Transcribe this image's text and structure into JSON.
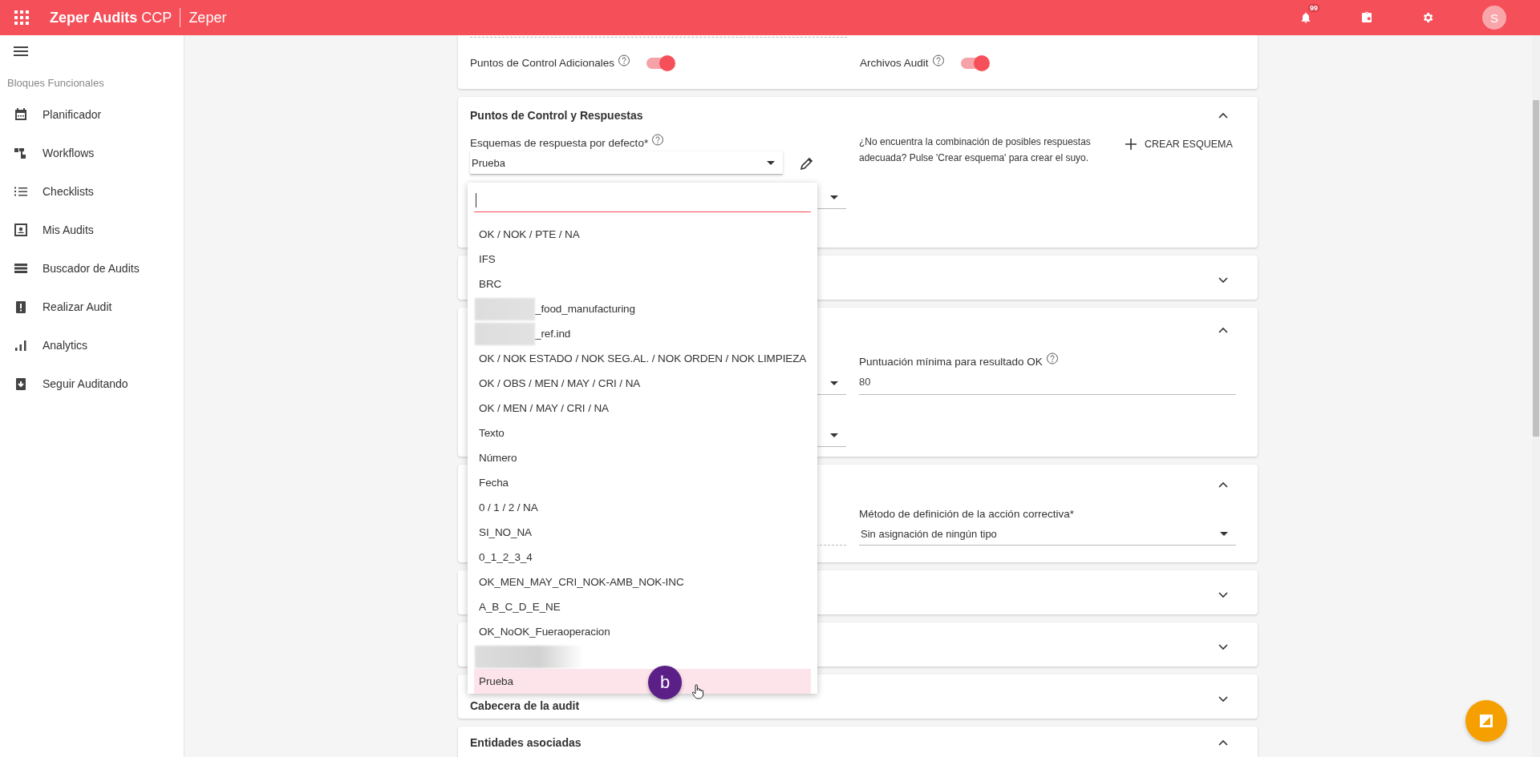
{
  "topbar": {
    "app_name": "**Zeper Audits** CCP",
    "org": "Zeper",
    "notifications_badge": "99",
    "avatar": "S"
  },
  "sidebar": {
    "section": "Bloques Funcionales",
    "items": [
      {
        "kind": "calendar",
        "label": "Planificador"
      },
      {
        "kind": "workflow",
        "label": "Workflows"
      },
      {
        "kind": "list",
        "label": "Checklists"
      },
      {
        "kind": "person",
        "label": "Mis Audits"
      },
      {
        "kind": "rows",
        "label": "Buscador de Audits"
      },
      {
        "kind": "alert",
        "label": "Realizar Audit"
      },
      {
        "kind": "bars",
        "label": "Analytics"
      },
      {
        "kind": "download",
        "label": "Seguir Auditando"
      }
    ]
  },
  "sections": [
    {
      "kind": "toggles",
      "toggles": [
        {
          "label": "Puntos de Control Adicionales",
          "on": true
        },
        {
          "label": "Archivos Audit",
          "on": true
        }
      ]
    },
    {
      "kind": "schemes",
      "title": "Puntos de Control y Respuestas",
      "expanded": true,
      "field_label": "Esquemas de respuesta por defecto*",
      "value": "Prueba",
      "hint": "¿No encuentra la combinación de posibles respuestas adecuada? Pulse 'Crear esquema' para crear el suyo.",
      "create_button": "CREAR ESQUEMA"
    },
    {
      "kind": "plain",
      "expanded": false
    },
    {
      "kind": "scoring",
      "expanded": true,
      "field_label": "Puntuación mínima para resultado OK",
      "value": "80"
    },
    {
      "kind": "corrective",
      "expanded": true,
      "field_label": "Método de definición de la acción correctiva*",
      "value": "Sin asignación de ningún tipo"
    },
    {
      "kind": "plain",
      "expanded": false
    },
    {
      "kind": "plain",
      "expanded": false
    },
    {
      "kind": "plain",
      "title": "Cabecera de la audit",
      "expanded": false
    },
    {
      "kind": "plain",
      "title": "Entidades asociadas",
      "expanded": true
    }
  ],
  "dropdown": {
    "options": [
      {
        "label": "OK / NOK / PTE / NA",
        "selected": false,
        "redacted": false
      },
      {
        "label": "IFS",
        "selected": false,
        "redacted": false
      },
      {
        "label": "BRC",
        "selected": false,
        "redacted": false
      },
      {
        "label": "_food_manufacturing",
        "selected": false,
        "redacted": true
      },
      {
        "label": "_ref.ind",
        "selected": false,
        "redacted": true
      },
      {
        "label": "OK / NOK ESTADO / NOK SEG.AL. / NOK ORDEN / NOK LIMPIEZA",
        "selected": false,
        "redacted": false
      },
      {
        "label": "OK / OBS / MEN / MAY / CRI / NA",
        "selected": false,
        "redacted": false
      },
      {
        "label": "OK / MEN / MAY / CRI / NA",
        "selected": false,
        "redacted": false
      },
      {
        "label": "Texto",
        "selected": false,
        "redacted": false
      },
      {
        "label": "Número",
        "selected": false,
        "redacted": false
      },
      {
        "label": "Fecha",
        "selected": false,
        "redacted": false
      },
      {
        "label": "0 / 1 / 2 / NA",
        "selected": false,
        "redacted": false
      },
      {
        "label": "SI_NO_NA",
        "selected": false,
        "redacted": false
      },
      {
        "label": "0_1_2_3_4",
        "selected": false,
        "redacted": false
      },
      {
        "label": "OK_MEN_MAY_CRI_NOK-AMB_NOK-INC",
        "selected": false,
        "redacted": false
      },
      {
        "label": "A_B_C_D_E_NE",
        "selected": false,
        "redacted": false
      },
      {
        "label": "OK_NoOK_Fueraoperacion",
        "selected": false,
        "redacted": false
      },
      {
        "selected": false,
        "redacted": true
      },
      {
        "label": "Prueba",
        "selected": true,
        "redacted": false
      }
    ]
  },
  "cursor_badge": "b"
}
